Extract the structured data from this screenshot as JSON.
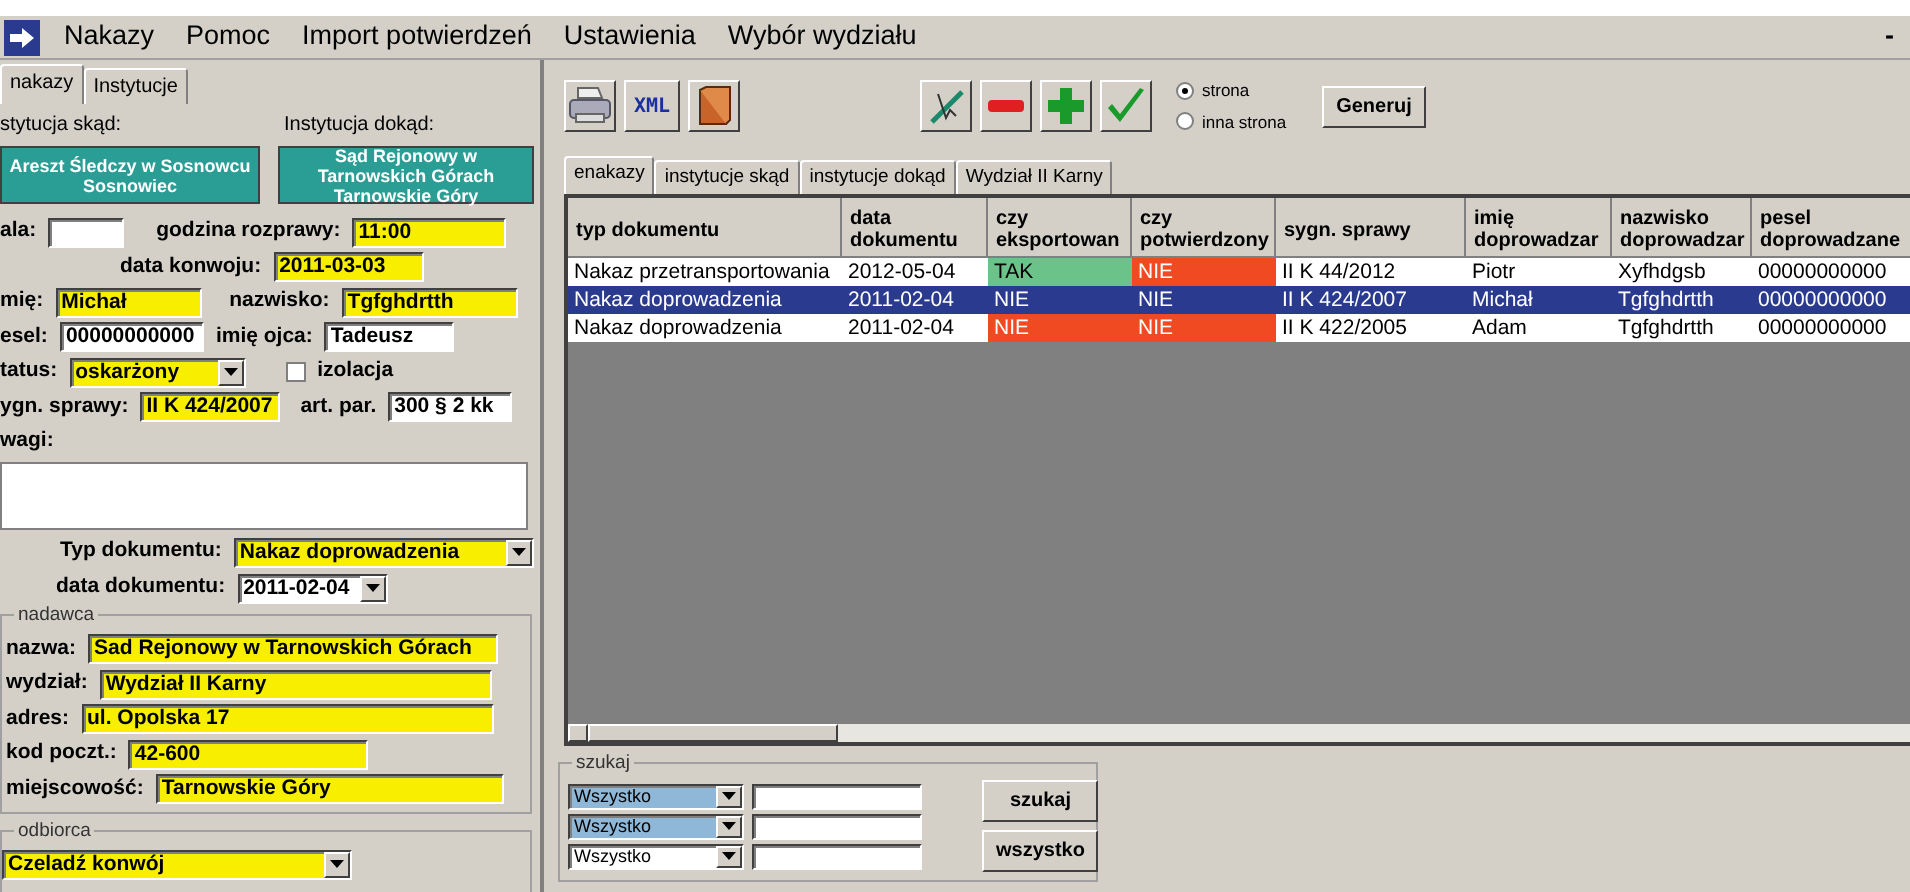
{
  "menu": {
    "items": [
      "Nakazy",
      "Pomoc",
      "Import potwierdzeń",
      "Ustawienia",
      "Wybór wydziału"
    ],
    "window_control": "-"
  },
  "left": {
    "tabs": [
      {
        "label": "nakazy",
        "selected": true
      },
      {
        "label": "Instytucje",
        "selected": false
      }
    ],
    "from_label": "stytucja skąd:",
    "to_label": "Instytucja dokąd:",
    "from_button": "Areszt Śledczy w Sosnowcu\nSosnowiec",
    "to_button": "Sąd Rejonowy w\nTarnowskich Górach\nTarnowskie Góry",
    "sala": {
      "label": "ala:"
    },
    "godzina": {
      "label": "godzina rozprawy:",
      "value": "11:00",
      "highlight": true
    },
    "data_konwoju": {
      "label": "data konwoju:",
      "value": "2011-03-03",
      "highlight": true
    },
    "imie": {
      "label": "mię:",
      "value": "Michał",
      "highlight": true
    },
    "nazwisko": {
      "label": "nazwisko:",
      "value": "Tgfghdrtth",
      "highlight": true
    },
    "pesel": {
      "label": "esel:",
      "value": "00000000000",
      "highlight": false
    },
    "imie_ojca": {
      "label": "imię ojca:",
      "value": "Tadeusz",
      "highlight": false
    },
    "status": {
      "label": "tatus:",
      "value": "oskarżony",
      "highlight": true
    },
    "izolacja": {
      "label": "izolacja",
      "checked": false
    },
    "sygn": {
      "label": "ygn. sprawy:",
      "value": "II K 424/2007",
      "highlight": true
    },
    "art": {
      "label": "art. par.",
      "value": "300 § 2 kk",
      "highlight": false
    },
    "uwagi": {
      "label": "wagi:"
    },
    "typ_dokumentu": {
      "label": "Typ dokumentu:",
      "value": "Nakaz doprowadzenia",
      "highlight": true
    },
    "data_dokumentu": {
      "label": "data dokumentu:",
      "value": "2011-02-04",
      "highlight": false
    },
    "nadawca": {
      "legend": "nadawca",
      "fields": [
        {
          "label": "nazwa:",
          "value": "Sad Rejonowy w Tarnowskich Górach",
          "highlight": true
        },
        {
          "label": "wydział:",
          "value": "Wydział II Karny",
          "highlight": true
        },
        {
          "label": "adres:",
          "value": "ul. Opolska 17",
          "highlight": true
        },
        {
          "label": "kod poczt.:",
          "value": "42-600",
          "highlight": true
        },
        {
          "label": "miejscowość:",
          "value": "Tarnowskie Góry",
          "highlight": true
        }
      ]
    },
    "odbiorca": {
      "legend": "odbiorca",
      "value": "Czeladź konwój",
      "highlight": true
    }
  },
  "right": {
    "xml_button": "XML",
    "radios": [
      {
        "label": "strona",
        "selected": true
      },
      {
        "label": "inna strona",
        "selected": false
      }
    ],
    "generate_button": "Generuj",
    "tabs": [
      {
        "label": "enakazy",
        "selected": true
      },
      {
        "label": "instytucje skąd",
        "selected": false
      },
      {
        "label": "instytucje dokąd",
        "selected": false
      },
      {
        "label": "Wydział II Karny",
        "selected": false
      }
    ],
    "table": {
      "columns": [
        "typ dokumentu",
        "data\ndokumentu",
        "czy\neksportowan",
        "czy\npotwierdzony",
        "sygn. sprawy",
        "imię\ndoprowadzar",
        "nazwisko\ndoprowadzar",
        "pesel\ndoprowadzane"
      ],
      "rows": [
        {
          "selected": false,
          "cells": [
            {
              "text": "Nakaz przetransportowania"
            },
            {
              "text": "2012-05-04"
            },
            {
              "text": "TAK",
              "color": "#6bc38a"
            },
            {
              "text": "NIE",
              "color": "#f04a23"
            },
            {
              "text": "II K 44/2012"
            },
            {
              "text": "Piotr"
            },
            {
              "text": "Xyfhdgsb"
            },
            {
              "text": "00000000000"
            }
          ]
        },
        {
          "selected": true,
          "cells": [
            {
              "text": "Nakaz doprowadzenia"
            },
            {
              "text": "2011-02-04"
            },
            {
              "text": "NIE"
            },
            {
              "text": "NIE"
            },
            {
              "text": "II K 424/2007"
            },
            {
              "text": "Michał"
            },
            {
              "text": "Tgfghdrtth"
            },
            {
              "text": "00000000000"
            }
          ]
        },
        {
          "selected": false,
          "cells": [
            {
              "text": "Nakaz doprowadzenia"
            },
            {
              "text": "2011-02-04"
            },
            {
              "text": "NIE",
              "color": "#f04a23"
            },
            {
              "text": "NIE",
              "color": "#f04a23"
            },
            {
              "text": "II K 422/2005"
            },
            {
              "text": "Adam"
            },
            {
              "text": "Tgfghdrtth"
            },
            {
              "text": "00000000000"
            }
          ]
        }
      ]
    },
    "search": {
      "legend": "szukaj",
      "filters": [
        {
          "value": "Wszystko",
          "highlight": true
        },
        {
          "value": "Wszystko",
          "highlight": true
        },
        {
          "value": "Wszystko",
          "highlight": false
        }
      ],
      "buttons": [
        "szukaj",
        "wszystko"
      ]
    }
  }
}
